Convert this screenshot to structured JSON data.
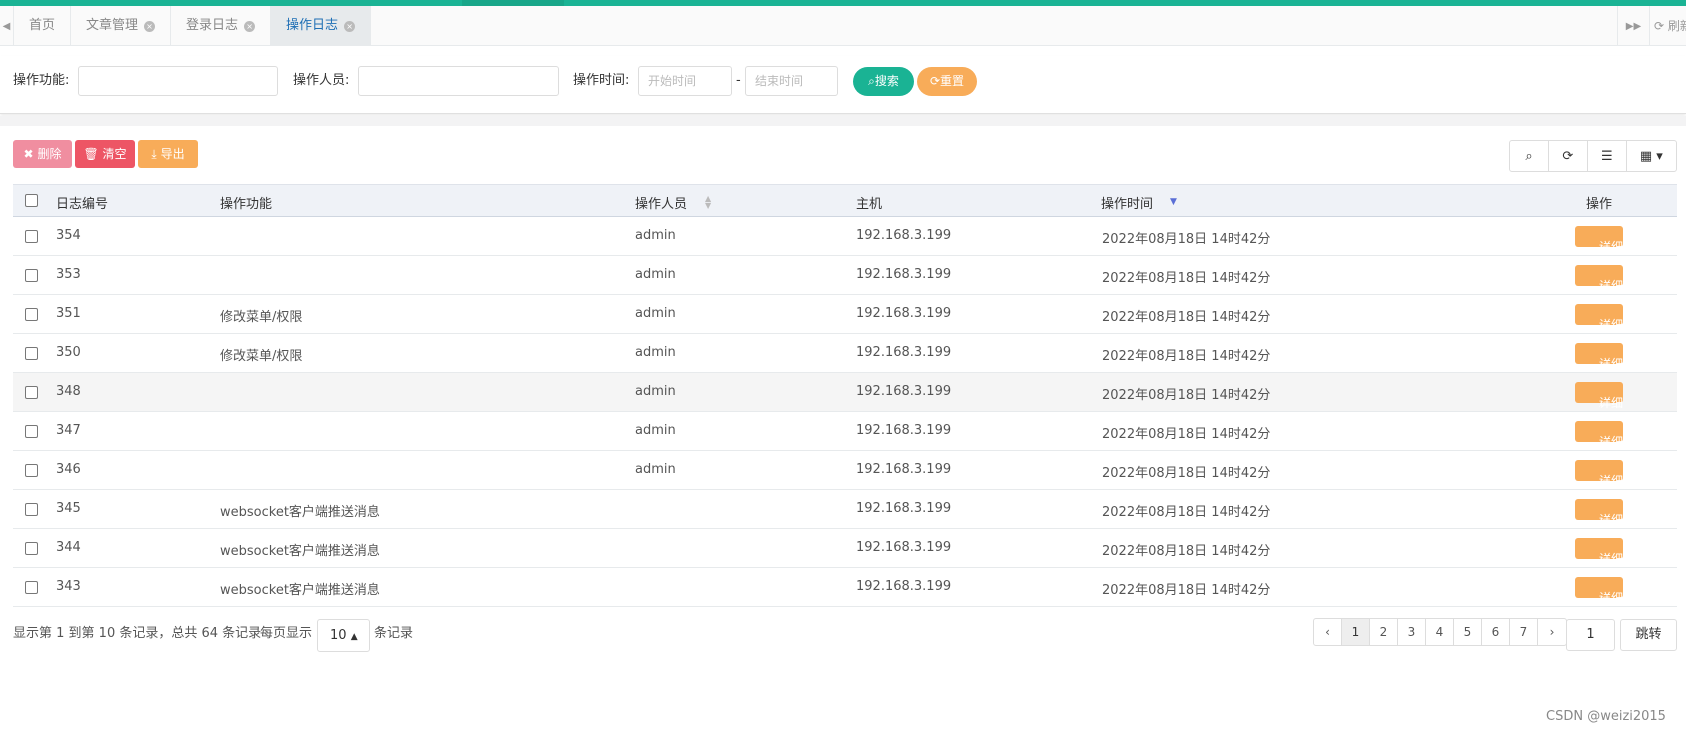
{
  "tabs": [
    {
      "label": "首页",
      "closable": false,
      "active": false
    },
    {
      "label": "文章管理",
      "closable": true,
      "active": false
    },
    {
      "label": "登录日志",
      "closable": true,
      "active": false
    },
    {
      "label": "操作日志",
      "closable": true,
      "active": true
    }
  ],
  "tabbar": {
    "refresh_label": "刷新"
  },
  "search": {
    "func_label": "操作功能:",
    "func_value": "",
    "user_label": "操作人员:",
    "user_value": "",
    "time_label": "操作时间:",
    "start_placeholder": "开始时间",
    "end_placeholder": "结束时间",
    "dash": "-",
    "search_label": "搜索",
    "reset_label": "重置"
  },
  "toolbar": {
    "delete_label": "删除",
    "clear_label": "清空",
    "export_label": "导出"
  },
  "table": {
    "headers": {
      "id": "日志编号",
      "func": "操作功能",
      "user": "操作人员",
      "host": "主机",
      "time": "操作时间",
      "action": "操作"
    },
    "sort": {
      "column": "操作时间",
      "direction": "desc"
    },
    "detail_label": "详细",
    "rows": [
      {
        "id": "354",
        "func": "",
        "user": "admin",
        "host": "192.168.3.199",
        "time": "2022年08月18日 14时42分"
      },
      {
        "id": "353",
        "func": "",
        "user": "admin",
        "host": "192.168.3.199",
        "time": "2022年08月18日 14时42分"
      },
      {
        "id": "351",
        "func": "修改菜单/权限",
        "user": "admin",
        "host": "192.168.3.199",
        "time": "2022年08月18日 14时42分"
      },
      {
        "id": "350",
        "func": "修改菜单/权限",
        "user": "admin",
        "host": "192.168.3.199",
        "time": "2022年08月18日 14时42分"
      },
      {
        "id": "348",
        "func": "",
        "user": "admin",
        "host": "192.168.3.199",
        "time": "2022年08月18日 14时42分"
      },
      {
        "id": "347",
        "func": "",
        "user": "admin",
        "host": "192.168.3.199",
        "time": "2022年08月18日 14时42分"
      },
      {
        "id": "346",
        "func": "",
        "user": "admin",
        "host": "192.168.3.199",
        "time": "2022年08月18日 14时42分"
      },
      {
        "id": "345",
        "func": "websocket客户端推送消息",
        "user": "",
        "host": "192.168.3.199",
        "time": "2022年08月18日 14时42分"
      },
      {
        "id": "344",
        "func": "websocket客户端推送消息",
        "user": "",
        "host": "192.168.3.199",
        "time": "2022年08月18日 14时42分"
      },
      {
        "id": "343",
        "func": "websocket客户端推送消息",
        "user": "",
        "host": "192.168.3.199",
        "time": "2022年08月18日 14时42分"
      }
    ]
  },
  "pagination": {
    "summary": "显示第 1 到第 10 条记录，总共 64 条记录",
    "per_page_prefix": "每页显示",
    "per_page_value": "10",
    "per_page_suffix": "条记录",
    "prev": "‹",
    "next": "›",
    "pages": [
      "1",
      "2",
      "3",
      "4",
      "5",
      "6",
      "7"
    ],
    "current_page": "1",
    "jump_value": "1",
    "jump_label": "跳转"
  },
  "watermark": "CSDN @weizi2015",
  "colors": {
    "primary": "#1ab394",
    "warning": "#f8ac59",
    "danger": "#ed5565",
    "tab_active_text": "#1f6fb5"
  }
}
